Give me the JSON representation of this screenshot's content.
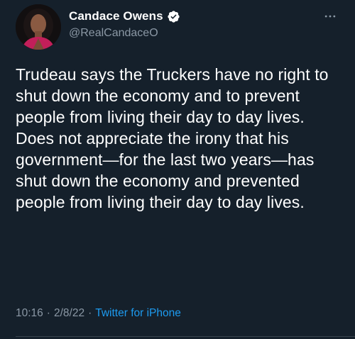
{
  "tweet": {
    "display_name": "Candace Owens",
    "handle": "@RealCandaceO",
    "more_icon": "more-horizontal-icon",
    "verified_icon": "verified-badge-icon",
    "text_lines": [
      "Trudeau says the Truckers have no right to shut down the economy and to prevent people from living their day to day lives.",
      "Does not appreciate the irony that his government—for the last two years—has shut down the economy and prevented people from living their day to day lives."
    ],
    "time": "10:16",
    "date": "2/8/22",
    "separator": "·",
    "source": "Twitter for iPhone"
  },
  "colors": {
    "background": "#15202b",
    "text": "#ffffff",
    "secondary_text": "#8b98a5",
    "accent": "#1d9bf0"
  }
}
